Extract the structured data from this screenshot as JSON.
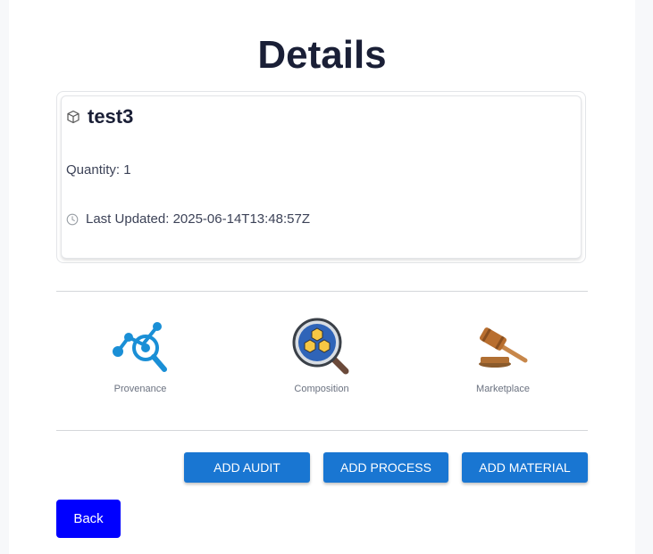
{
  "page": {
    "title": "Details"
  },
  "item": {
    "name": "test3",
    "quantity": "Quantity: 1",
    "last_updated": "Last Updated: 2025-06-14T13:48:57Z"
  },
  "features": [
    {
      "label": "Provenance",
      "icon": "provenance-icon"
    },
    {
      "label": "Composition",
      "icon": "composition-icon"
    },
    {
      "label": "Marketplace",
      "icon": "marketplace-gavel-icon"
    }
  ],
  "actions": {
    "add_audit": "ADD AUDIT",
    "add_process": "ADD PROCESS",
    "add_material": "ADD MATERIAL",
    "back": "Back"
  },
  "colors": {
    "primary": "#1976d2",
    "back_button": "#0000ff",
    "title": "#1a1f36"
  }
}
